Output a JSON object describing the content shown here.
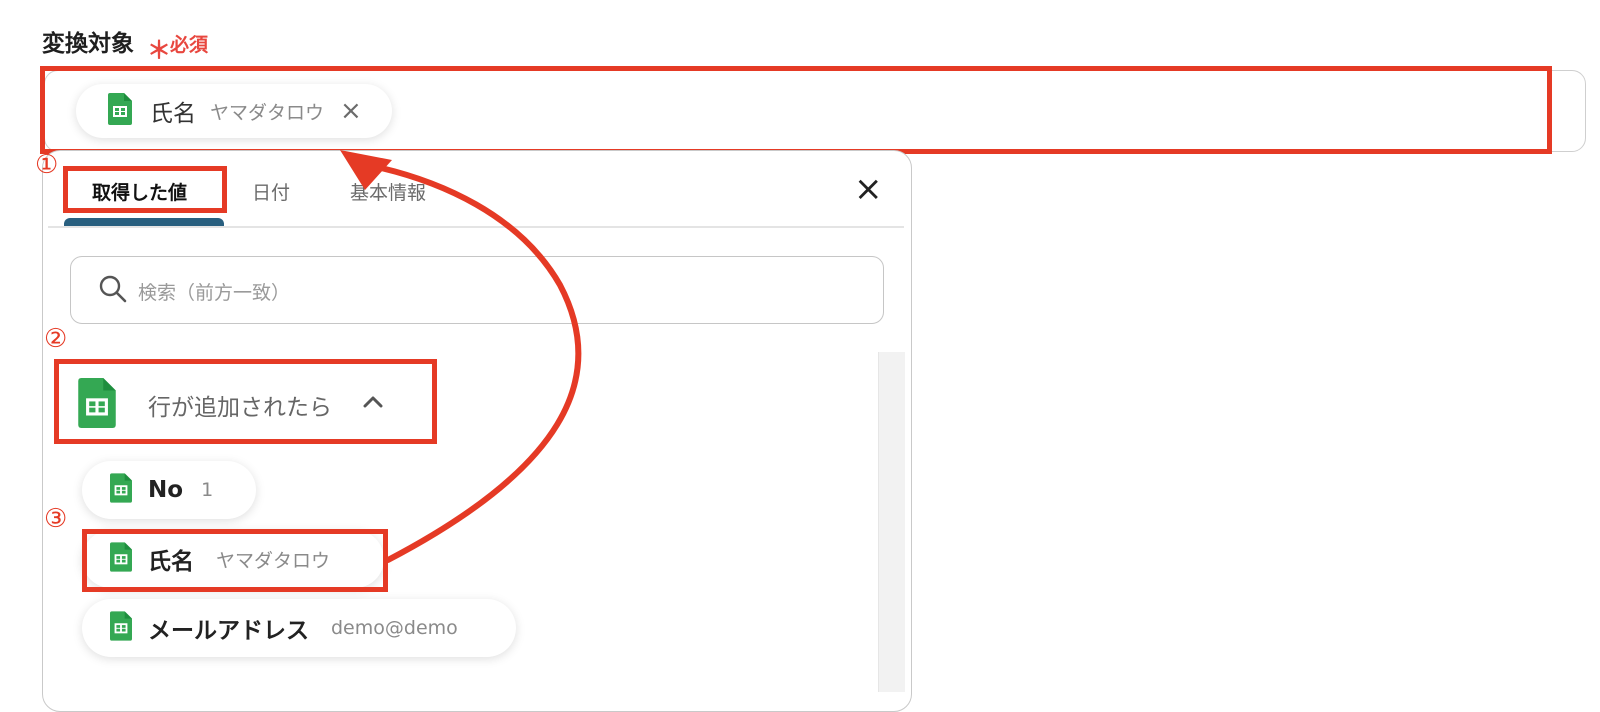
{
  "field": {
    "label": "変換対象",
    "required_mark": "＊",
    "required_text": "必須"
  },
  "target": {
    "chip_name": "氏名",
    "chip_value": "ヤマダタロウ",
    "remove_symbol": "×"
  },
  "popup": {
    "tabs": [
      {
        "label": "取得した値"
      },
      {
        "label": "日付"
      },
      {
        "label": "基本情報"
      }
    ],
    "close_symbol": "×",
    "search": {
      "placeholder": "検索（前方一致）"
    },
    "group": {
      "label": "行が追加されたら"
    },
    "items": [
      {
        "name": "No",
        "value": "1"
      },
      {
        "name": "氏名",
        "value": "ヤマダタロウ"
      },
      {
        "name": "メールアドレス",
        "value": "demo@demo"
      }
    ]
  },
  "annotations": {
    "step1": "①",
    "step2": "②",
    "step3": "③",
    "color": "#e53a25"
  },
  "colors": {
    "accent": "#e53a25",
    "sheets_green": "#34a853",
    "tab_underline": "#285f7f",
    "required": "#e8473f"
  },
  "icons": {
    "sheet": "google-sheets-icon",
    "search": "search-icon",
    "close": "close-icon",
    "chevron": "chevron-up-icon"
  }
}
